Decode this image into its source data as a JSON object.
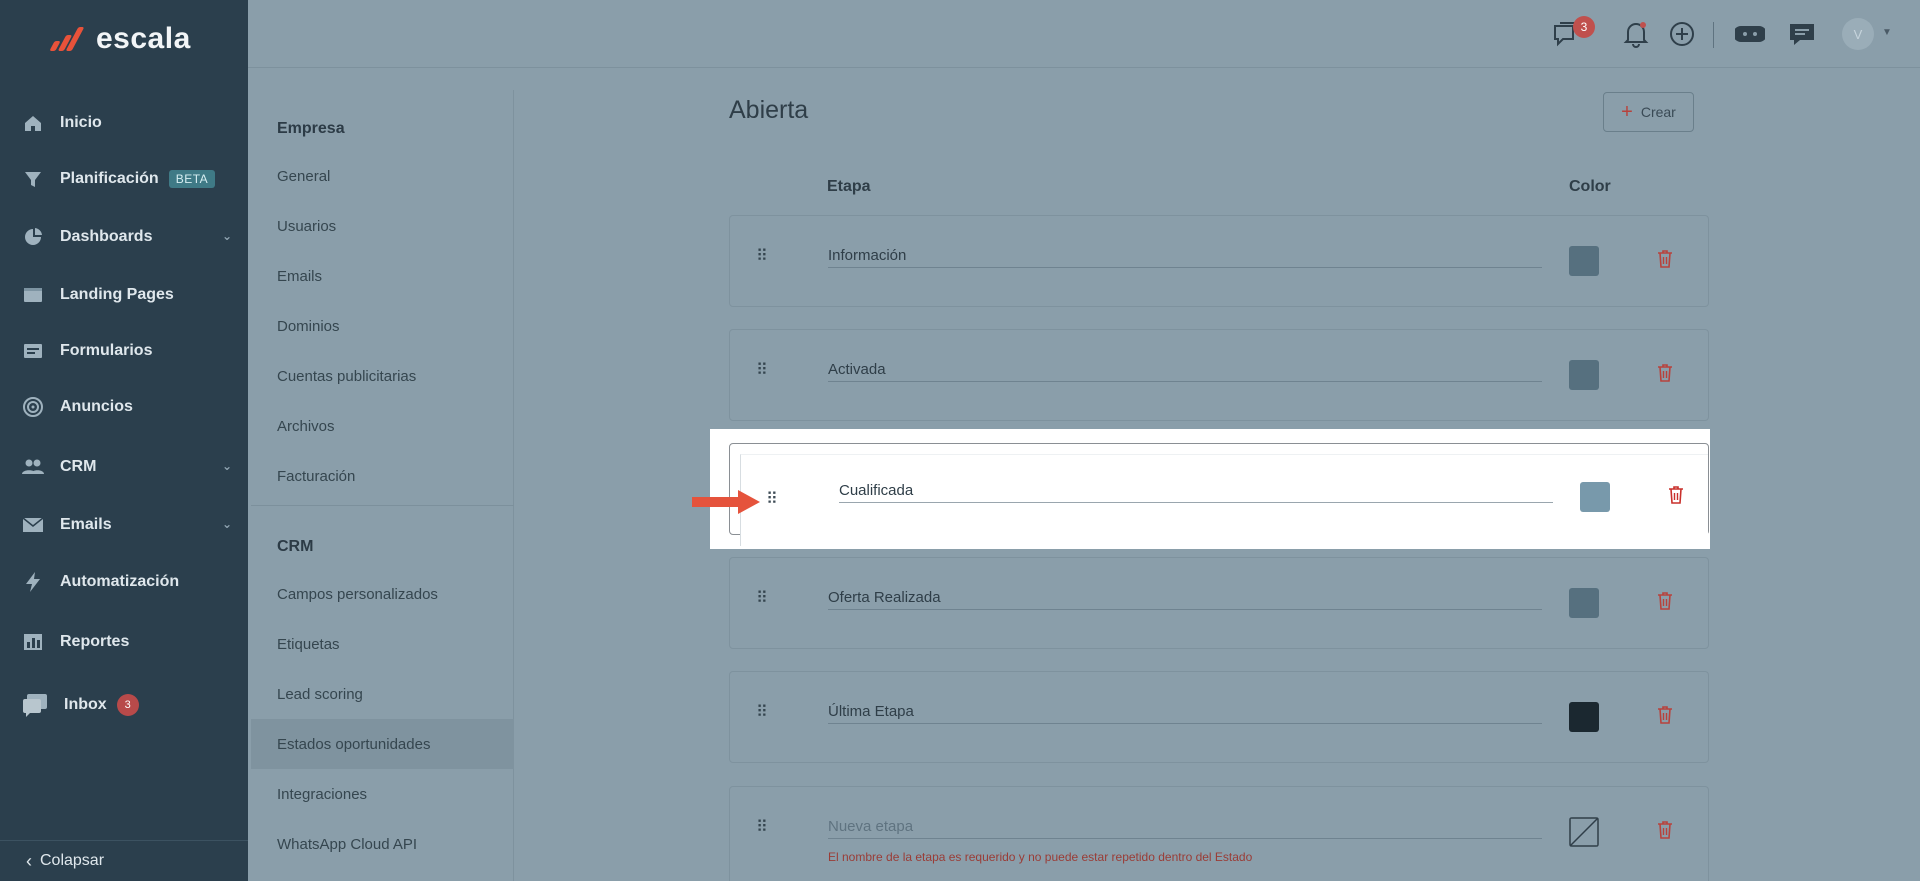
{
  "brand": {
    "name": "escala"
  },
  "sidebar": {
    "items": [
      {
        "label": "Inicio",
        "icon": "home-icon"
      },
      {
        "label": "Planificación",
        "icon": "funnel-icon",
        "badge": "BETA"
      },
      {
        "label": "Dashboards",
        "icon": "pie-chart-icon",
        "expandable": true
      },
      {
        "label": "Landing Pages",
        "icon": "browser-icon"
      },
      {
        "label": "Formularios",
        "icon": "form-icon"
      },
      {
        "label": "Anuncios",
        "icon": "target-icon"
      },
      {
        "label": "CRM",
        "icon": "users-icon",
        "expandable": true
      },
      {
        "label": "Emails",
        "icon": "envelope-icon",
        "expandable": true
      },
      {
        "label": "Automatización",
        "icon": "bolt-icon"
      },
      {
        "label": "Reportes",
        "icon": "report-icon"
      },
      {
        "label": "Inbox",
        "icon": "inbox-icon",
        "count": "3"
      }
    ],
    "collapse_label": "Colapsar"
  },
  "topbar": {
    "chat_badge": "3",
    "avatar_initial": "V"
  },
  "settings": {
    "empresa_header": "Empresa",
    "empresa_items": [
      "General",
      "Usuarios",
      "Emails",
      "Dominios",
      "Cuentas publicitarias",
      "Archivos",
      "Facturación"
    ],
    "crm_header": "CRM",
    "crm_items": [
      "Campos personalizados",
      "Etiquetas",
      "Lead scoring",
      "Estados oportunidades",
      "Integraciones",
      "WhatsApp Cloud API"
    ],
    "active_item": "Estados oportunidades"
  },
  "main": {
    "title": "Abierta",
    "create_label": "Crear",
    "col_stage": "Etapa",
    "col_color": "Color",
    "stages": [
      {
        "name": "Información",
        "color": "#56707f"
      },
      {
        "name": "Activada",
        "color": "#56707f"
      },
      {
        "name": "Oferta Realizada",
        "color": "#56707f"
      },
      {
        "name": "Última Etapa",
        "color": "#1b2830"
      }
    ],
    "dragged_stage": {
      "name": "Cualificada",
      "color": "#7899ab"
    },
    "new_stage": {
      "placeholder": "Nueva etapa",
      "error": "El nombre de la etapa es requerido y no puede estar repetido dentro del Estado"
    }
  }
}
